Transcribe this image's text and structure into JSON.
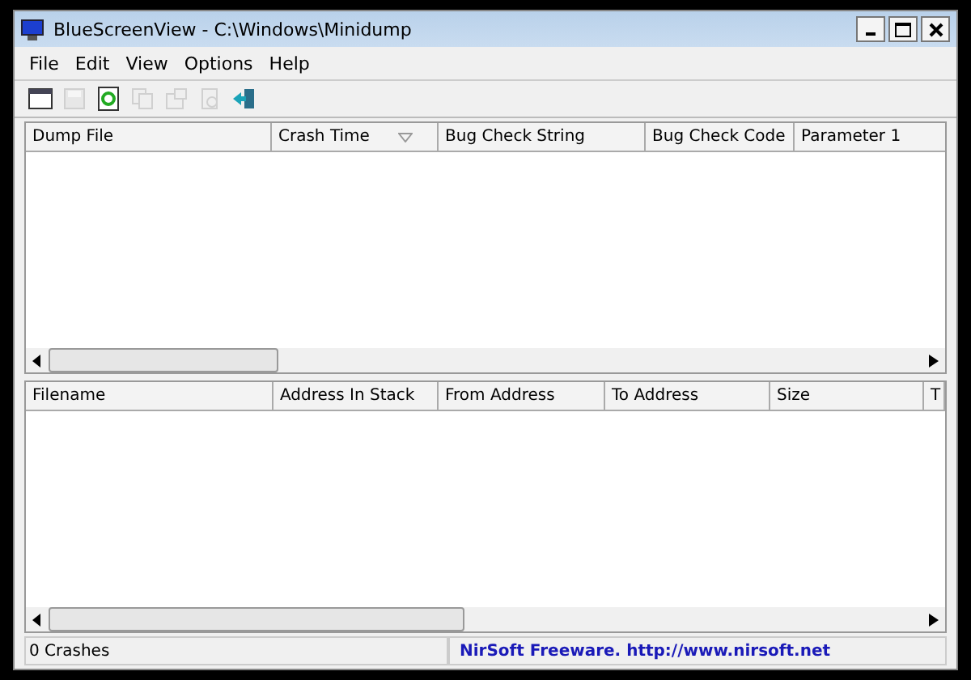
{
  "window": {
    "title": "BlueScreenView  -  C:\\Windows\\Minidump"
  },
  "menu": [
    "File",
    "Edit",
    "View",
    "Options",
    "Help"
  ],
  "toolbar": [
    {
      "kind": "report",
      "disabled": false
    },
    {
      "kind": "save",
      "disabled": true
    },
    {
      "kind": "refresh",
      "disabled": false
    },
    {
      "kind": "copy",
      "disabled": true
    },
    {
      "kind": "properties",
      "disabled": true
    },
    {
      "kind": "find",
      "disabled": true
    },
    {
      "kind": "exit",
      "disabled": false
    }
  ],
  "crash_list": {
    "columns": [
      {
        "label": "Dump File",
        "sorted": false
      },
      {
        "label": "Crash Time",
        "sorted": true
      },
      {
        "label": "Bug Check String",
        "sorted": false
      },
      {
        "label": "Bug Check Code",
        "sorted": false
      },
      {
        "label": "Parameter 1",
        "sorted": false
      }
    ]
  },
  "driver_list": {
    "columns": [
      {
        "label": "Filename"
      },
      {
        "label": "Address In Stack"
      },
      {
        "label": "From Address"
      },
      {
        "label": "To Address"
      },
      {
        "label": "Size"
      },
      {
        "label": "T"
      }
    ]
  },
  "status_bar": {
    "count": "0 Crashes",
    "credit": "NirSoft Freeware.  http://www.nirsoft.net"
  }
}
